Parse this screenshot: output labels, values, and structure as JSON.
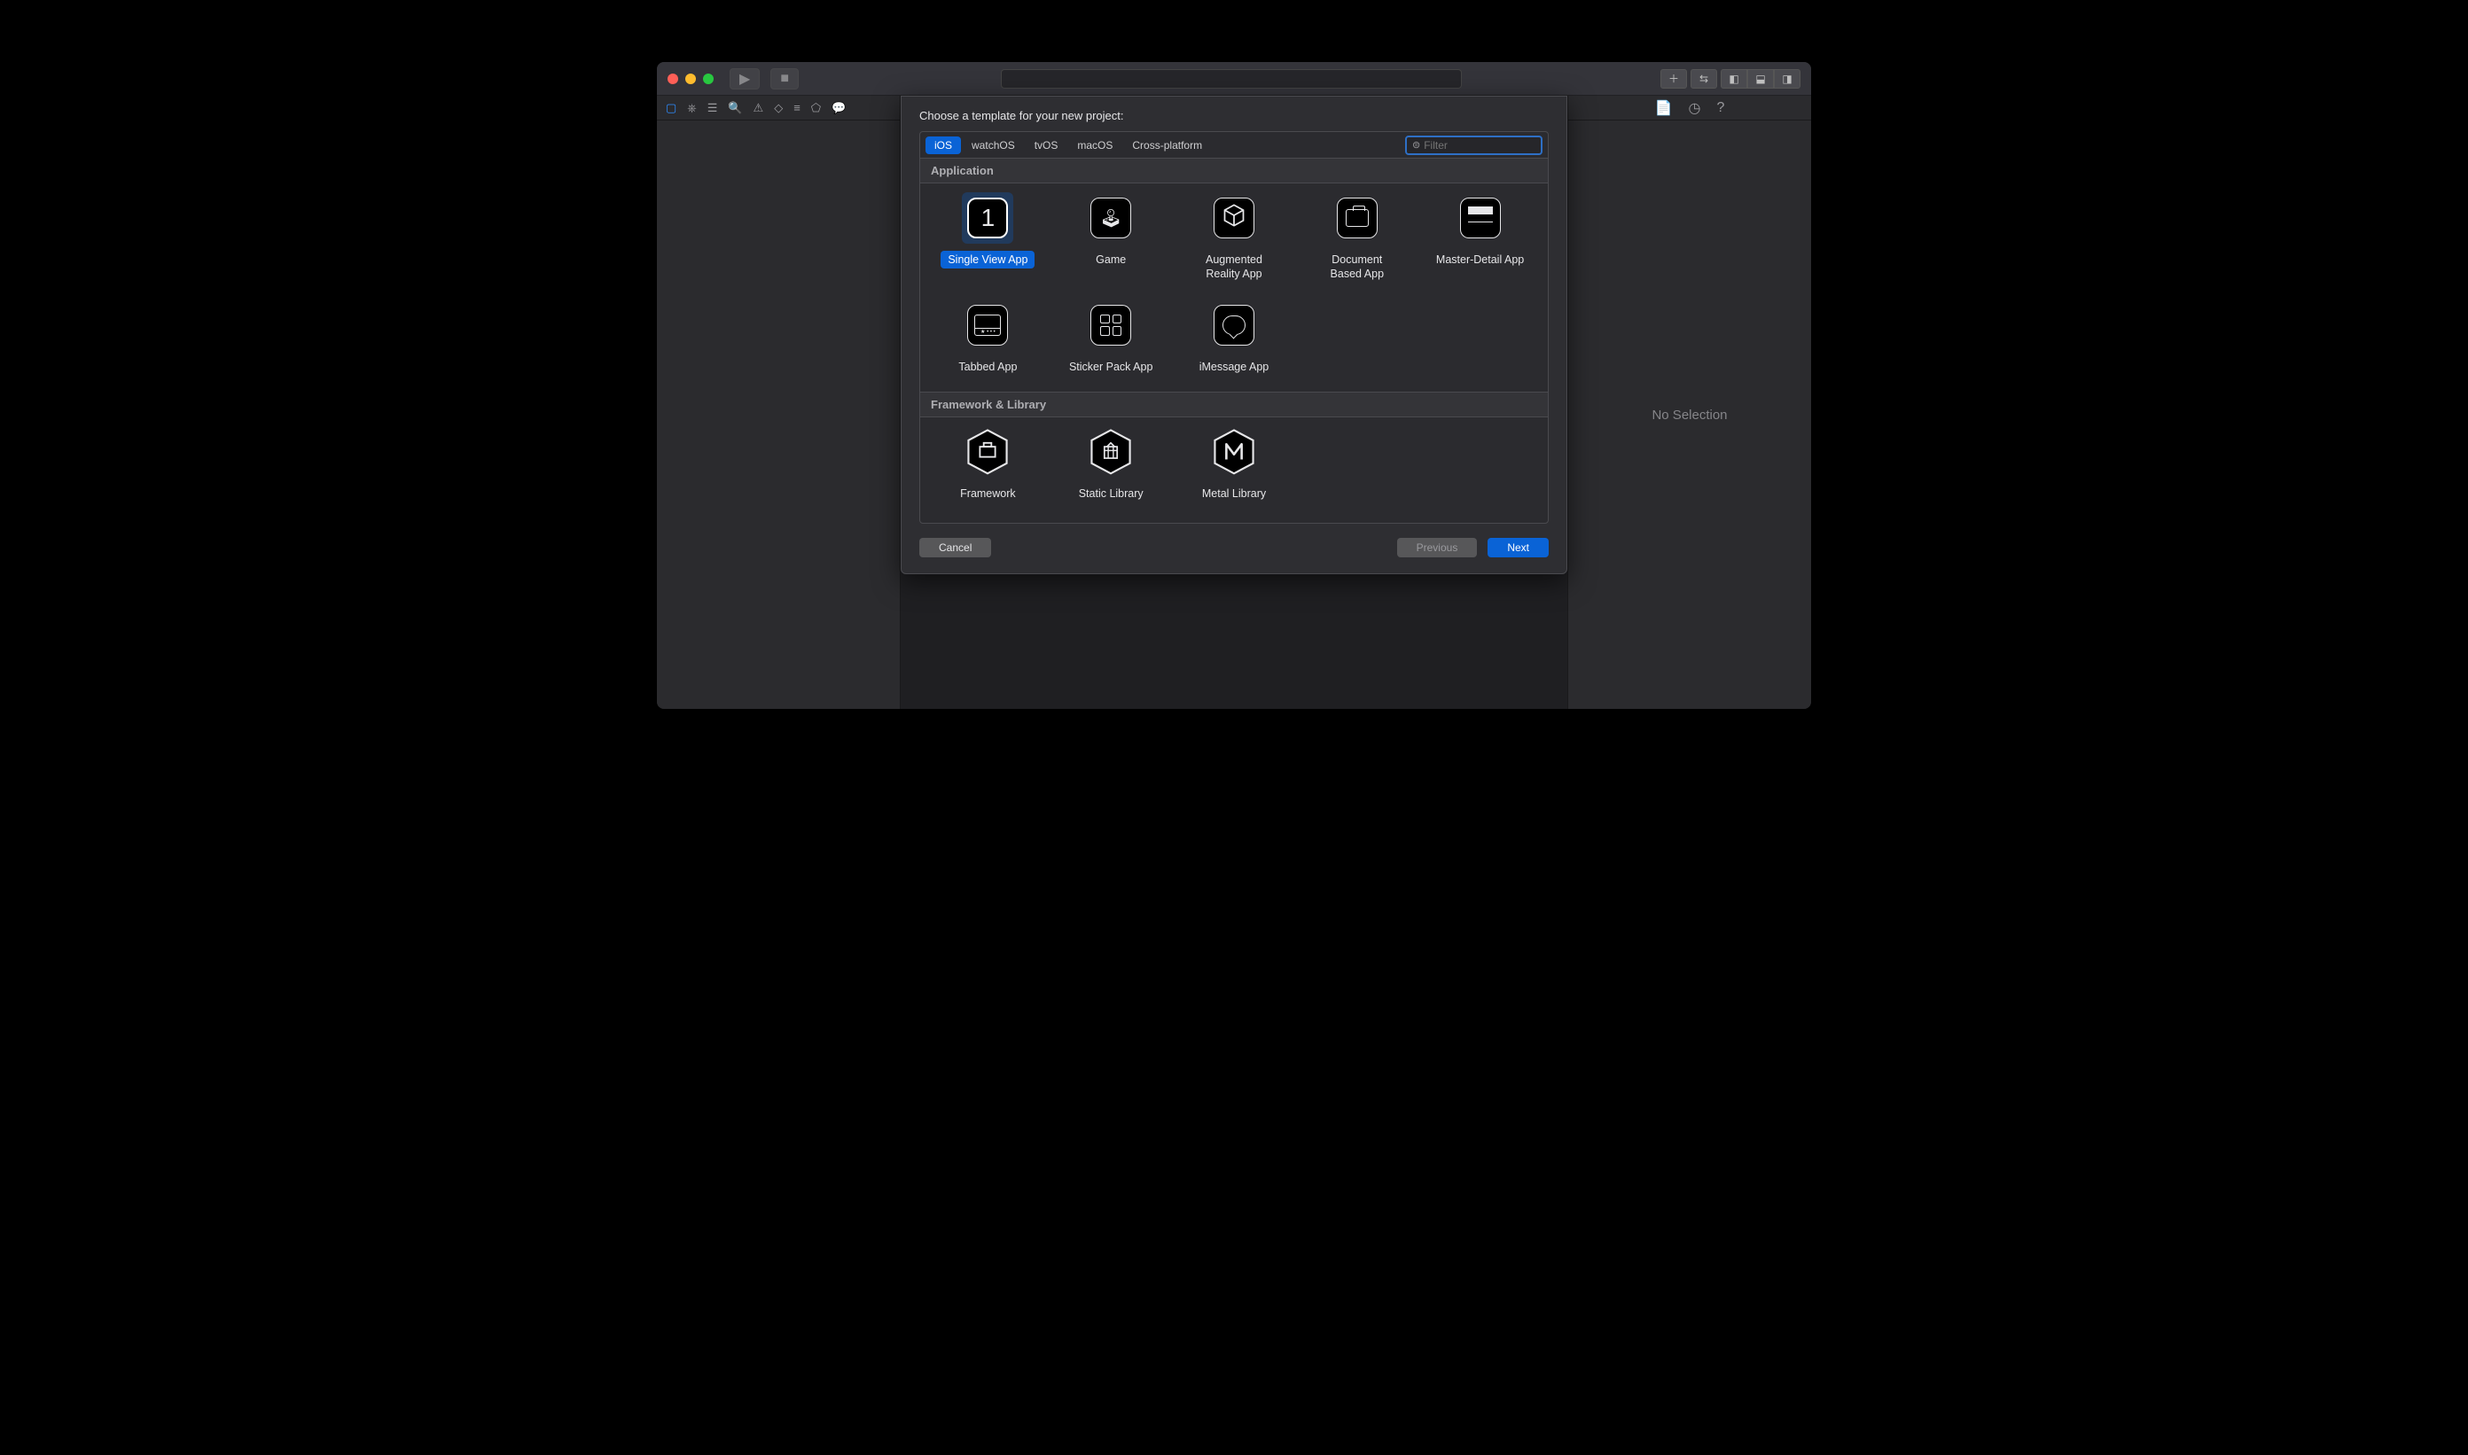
{
  "toolbar": {
    "title_field": ""
  },
  "sheet": {
    "title": "Choose a template for your new project:",
    "filter_placeholder": "Filter",
    "platforms": [
      "iOS",
      "watchOS",
      "tvOS",
      "macOS",
      "Cross-platform"
    ],
    "selected_platform": "iOS",
    "sections": {
      "application": {
        "title": "Application",
        "items": [
          {
            "label": "Single View App",
            "icon": "one",
            "selected": true
          },
          {
            "label": "Game",
            "icon": "sprite"
          },
          {
            "label": "Augmented\nReality App",
            "icon": "cube"
          },
          {
            "label": "Document\nBased App",
            "icon": "folder"
          },
          {
            "label": "Master-Detail App",
            "icon": "master-detail"
          },
          {
            "label": "Tabbed App",
            "icon": "tabbar"
          },
          {
            "label": "Sticker Pack App",
            "icon": "grid4"
          },
          {
            "label": "iMessage App",
            "icon": "bubble"
          }
        ]
      },
      "framework": {
        "title": "Framework & Library",
        "items": [
          {
            "label": "Framework",
            "icon": "hex-toolbox"
          },
          {
            "label": "Static Library",
            "icon": "hex-building"
          },
          {
            "label": "Metal Library",
            "icon": "hex-m"
          }
        ]
      }
    },
    "buttons": {
      "cancel": "Cancel",
      "previous": "Previous",
      "next": "Next"
    }
  },
  "inspector": {
    "no_selection": "No Selection"
  }
}
